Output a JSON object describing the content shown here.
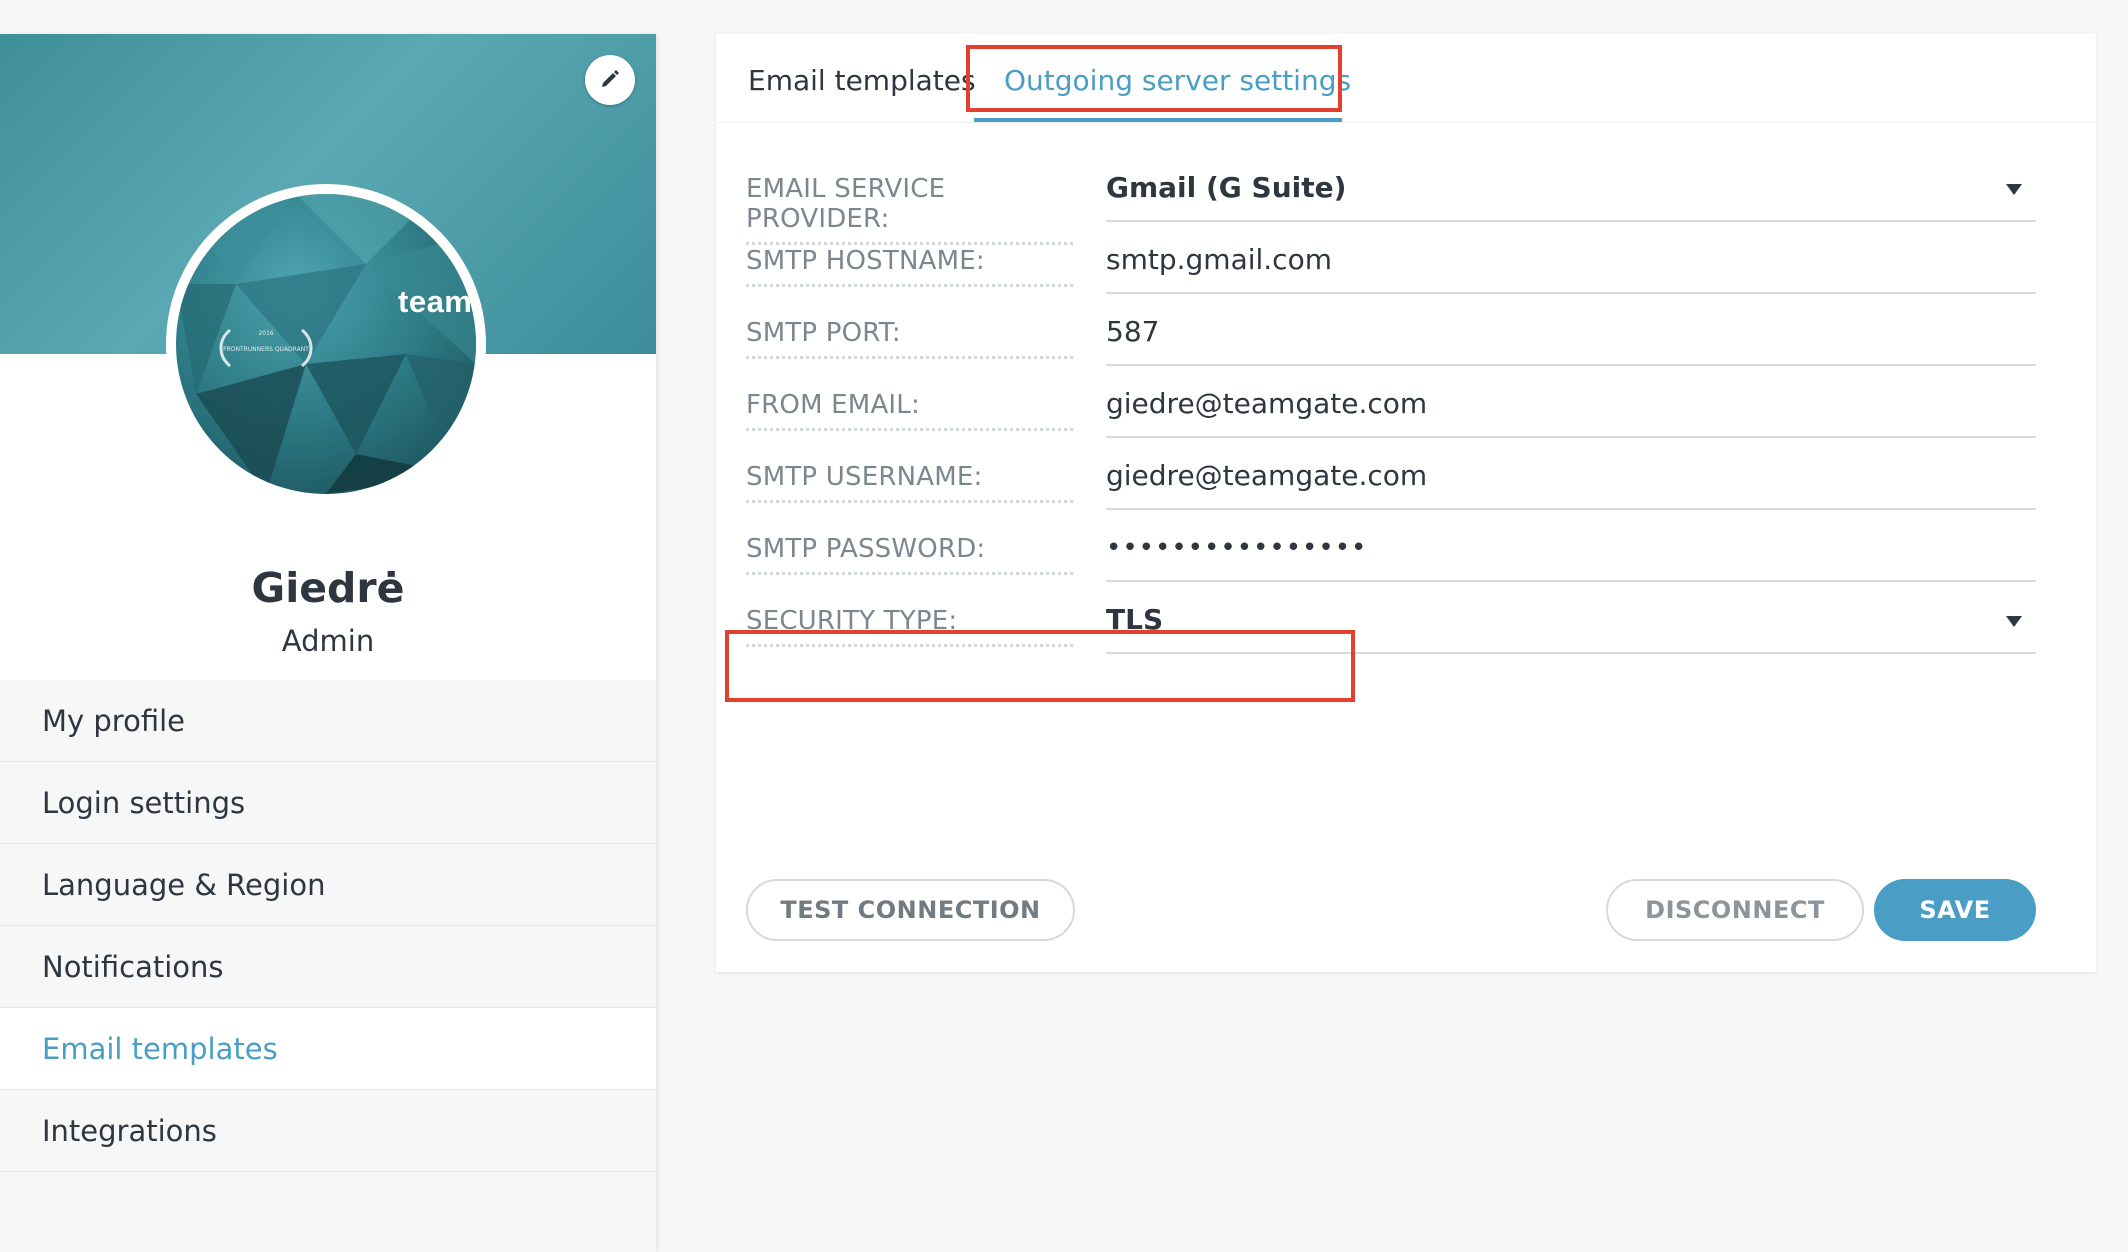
{
  "profile": {
    "name": "Giedrė",
    "role": "Admin",
    "avatar_text": "team",
    "badge_year": "2016",
    "badge_text": "FRONTRUNNERS QUADRANT"
  },
  "sidebar": {
    "items": [
      {
        "label": "My profile"
      },
      {
        "label": "Login settings"
      },
      {
        "label": "Language & Region"
      },
      {
        "label": "Notifications"
      },
      {
        "label": "Email templates",
        "active": true
      },
      {
        "label": "Integrations"
      }
    ]
  },
  "tabs": {
    "email_templates": "Email templates",
    "outgoing": "Outgoing server settings",
    "active": "Outgoing server settings"
  },
  "form": {
    "provider": {
      "label": "EMAIL SERVICE PROVIDER:",
      "value": "Gmail (G Suite)"
    },
    "hostname": {
      "label": "SMTP HOSTNAME:",
      "value": "smtp.gmail.com"
    },
    "port": {
      "label": "SMTP PORT:",
      "value": "587"
    },
    "from_email": {
      "label": "FROM EMAIL:",
      "value": "giedre@teamgate.com"
    },
    "username": {
      "label": "SMTP USERNAME:",
      "value": "giedre@teamgate.com"
    },
    "password": {
      "label": "SMTP PASSWORD:",
      "value": "••••••••••••••••"
    },
    "security": {
      "label": "SECURITY TYPE:",
      "value": "TLS"
    }
  },
  "buttons": {
    "test": "TEST CONNECTION",
    "disconnect": "DISCONNECT",
    "save": "SAVE"
  },
  "colors": {
    "accent": "#4a9ec5",
    "highlight": "#e2412e",
    "cover": "#4a9aa6"
  }
}
